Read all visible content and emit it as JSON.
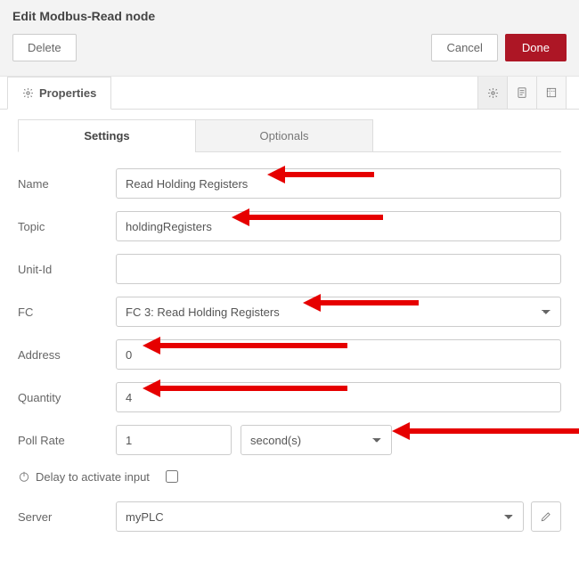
{
  "header": {
    "title": "Edit Modbus-Read node",
    "delete_label": "Delete",
    "cancel_label": "Cancel",
    "done_label": "Done",
    "properties_tab": "Properties"
  },
  "inner_tabs": {
    "settings": "Settings",
    "optionals": "Optionals"
  },
  "form": {
    "name": {
      "label": "Name",
      "value": "Read Holding Registers"
    },
    "topic": {
      "label": "Topic",
      "value": "holdingRegisters"
    },
    "unit_id": {
      "label": "Unit-Id",
      "value": ""
    },
    "fc": {
      "label": "FC",
      "selected": "FC 3: Read Holding Registers"
    },
    "address": {
      "label": "Address",
      "value": "0"
    },
    "quantity": {
      "label": "Quantity",
      "value": "4"
    },
    "poll_rate": {
      "label": "Poll Rate",
      "value": "1",
      "unit": "second(s)"
    },
    "delay_label": "Delay to activate input",
    "server": {
      "label": "Server",
      "selected": "myPLC"
    }
  },
  "icons": {
    "gear": "gear-icon",
    "doc": "doc-icon",
    "resize": "resize-icon",
    "power": "power-icon",
    "pencil": "pencil-icon"
  }
}
